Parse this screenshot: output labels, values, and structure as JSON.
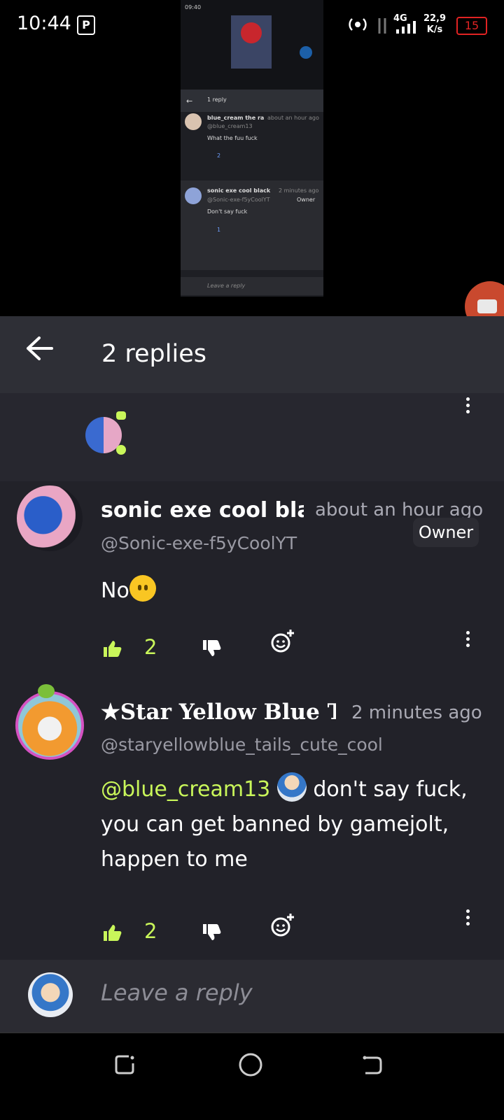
{
  "status_bar": {
    "time": "10:44",
    "p_badge": "P",
    "network": "4G",
    "speed_value": "22,9",
    "speed_unit": "K/s",
    "battery": "15"
  },
  "embedded": {
    "time": "09:40",
    "header_title": "1 reply",
    "comment1": {
      "name": "blue_cream the ra",
      "time": "about an hour ago",
      "handle": "@blue_cream13",
      "text": "What the fuu fuck",
      "likes": "2"
    },
    "comment2": {
      "name": "sonic exe cool black",
      "time": "2 minutes ago",
      "handle": "@Sonic-exe-f5yCoolYT",
      "badge": "Owner",
      "text": "Don't say fuck",
      "likes": "1"
    },
    "reply_placeholder": "Leave a reply"
  },
  "header": {
    "title": "2 replies"
  },
  "comments": [
    {
      "name": "sonic exe cool bla",
      "time": "about an hour ago",
      "handle": "@Sonic-exe-f5yCoolYT",
      "badge": "Owner",
      "text": "No",
      "likes": "2"
    },
    {
      "name": "★Star Yellow Blue Tai",
      "time": "2 minutes ago",
      "handle": "@staryellowblue_tails_cute_cool",
      "mention": "@blue_cream13",
      "text_line1": "don't say fuck,",
      "text_rest": "you can get banned by gamejolt, happen to me",
      "likes": "2"
    }
  ],
  "reply_bar": {
    "placeholder": "Leave a reply"
  },
  "colors": {
    "accent": "#c9f65a",
    "background": "#222229",
    "header": "#2e2f36"
  }
}
